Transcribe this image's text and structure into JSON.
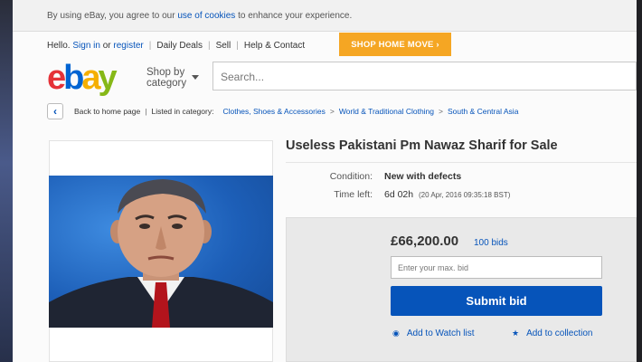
{
  "cookie_bar": {
    "prefix": "By using eBay, you agree to our ",
    "link": "use of cookies",
    "suffix": " to enhance your experience."
  },
  "topnav": {
    "hello": "Hello.",
    "signin": "Sign in",
    "or": "or",
    "register": "register",
    "daily_deals": "Daily Deals",
    "sell": "Sell",
    "help": "Help & Contact",
    "promo": "SHOP HOME MOVE ›"
  },
  "logo": {
    "e": "e",
    "b": "b",
    "a": "a",
    "y": "y"
  },
  "header": {
    "shop_by_line1": "Shop by",
    "shop_by_line2": "category"
  },
  "search": {
    "placeholder": "Search..."
  },
  "breadcrumb": {
    "back": "Back to home page",
    "listed": "Listed in category:",
    "items": [
      "Clothes, Shoes & Accessories",
      "World & Traditional Clothing",
      "South & Central Asia"
    ]
  },
  "listing": {
    "title": "Useless Pakistani Pm Nawaz Sharif for Sale",
    "condition_label": "Condition:",
    "condition_value": "New with defects",
    "time_label": "Time left:",
    "time_value": "6d 02h",
    "time_detail": "(20 Apr, 2016   09:35:18 BST)"
  },
  "bid": {
    "price": "£66,200.00",
    "bids": "100 bids",
    "input_placeholder": "Enter your max. bid",
    "submit": "Submit bid",
    "watch": "Add to Watch list",
    "collection": "Add to collection"
  },
  "colors": {
    "ebay_blue": "#0654ba",
    "promo_orange": "#f5a623",
    "logo_red": "#e53238",
    "logo_blue": "#0064d2",
    "logo_yellow": "#f5af02",
    "logo_green": "#86b817"
  }
}
